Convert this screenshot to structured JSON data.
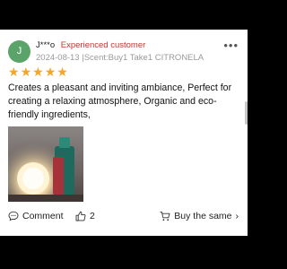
{
  "review": {
    "avatar_initial": "J",
    "username": "J***o",
    "badge": "Experienced customer",
    "date": "2024-08-13",
    "scent_separator": "|",
    "scent": "Scent:Buy1 Take1 CITRONELA",
    "rating": 5,
    "stars": [
      "★",
      "★",
      "★",
      "★",
      "★"
    ],
    "text": "Creates a pleasant and inviting ambiance, Perfect for creating a relaxing atmosphere, Organic and eco-friendly ingredients,"
  },
  "actions": {
    "comment_label": "Comment",
    "like_count": "2",
    "buy_same_label": "Buy the same",
    "buy_chevron": "›"
  },
  "menu": {
    "more_glyph": "•••"
  },
  "colors": {
    "avatar_bg": "#5aa469",
    "badge": "#c0392b",
    "star": "#f6a623",
    "meta_text": "#9a9a9a"
  },
  "icons": [
    "more-options-icon",
    "star-icon",
    "comment-icon",
    "thumbs-up-icon",
    "cart-icon",
    "chevron-right-icon"
  ]
}
